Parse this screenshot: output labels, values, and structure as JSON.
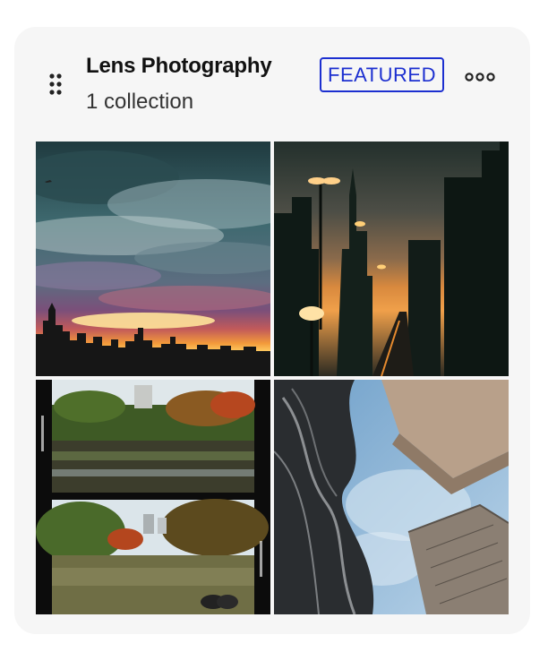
{
  "collection_card": {
    "title": "Lens Photography",
    "subtitle": "1 collection",
    "badge": "FEATURED",
    "drag_icon": "drag-handle-icon",
    "more_icon": "more-options-icon",
    "accent_color": "#1c2fd0",
    "photos": [
      {
        "name": "stormy-sunset-skyline"
      },
      {
        "name": "dusk-street-towers"
      },
      {
        "name": "park-lake-film-frames"
      },
      {
        "name": "looking-up-buildings"
      }
    ]
  }
}
